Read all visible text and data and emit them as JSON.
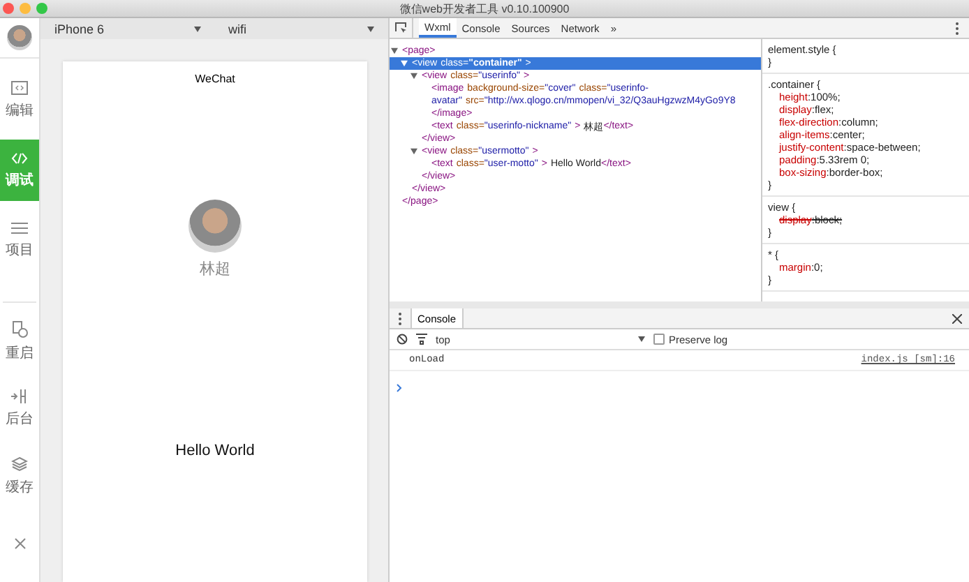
{
  "window": {
    "title": "微信web开发者工具 v0.10.100900"
  },
  "sidebar": {
    "items": [
      {
        "label": "编辑",
        "selected": false
      },
      {
        "label": "调试",
        "selected": true
      },
      {
        "label": "项目",
        "selected": false
      }
    ],
    "bottom_items": [
      {
        "label": "重启",
        "selected": false
      },
      {
        "label": "后台",
        "selected": false
      },
      {
        "label": "缓存",
        "selected": false
      },
      {
        "selected": false
      }
    ]
  },
  "simulator": {
    "device": "iPhone 6",
    "network": "wifi",
    "nav_title": "WeChat",
    "nickname": "林超",
    "motto": "Hello World"
  },
  "devtools": {
    "tabs": [
      {
        "label": "Wxml",
        "selected": true
      },
      {
        "label": "Console",
        "selected": false
      },
      {
        "label": "Sources",
        "selected": false
      },
      {
        "label": "Network",
        "selected": false
      }
    ],
    "more": "»",
    "tree": [
      {
        "kind": "element",
        "expanded": true,
        "selected": false,
        "open": [
          [
            {
              "kind": "tag",
              "s": "<page>"
            }
          ]
        ],
        "close": [
          {
            "kind": "tag",
            "s": "</page>"
          }
        ],
        "children": [
          {
            "kind": "element",
            "expanded": true,
            "selected": true,
            "open": [
              [
                {
                  "kind": "tag",
                  "s": "<view"
                },
                {
                  "kind": "attr",
                  "s": "class="
                },
                {
                  "kind": "value",
                  "s": "\"container\""
                },
                {
                  "kind": "tag",
                  "s": ">"
                }
              ]
            ],
            "close": [
              {
                "kind": "tag",
                "s": "</view>"
              }
            ],
            "children": [
              {
                "kind": "element",
                "expanded": true,
                "selected": false,
                "open": [
                  [
                    {
                      "kind": "tag",
                      "s": "<view"
                    },
                    {
                      "kind": "attr",
                      "s": "class="
                    },
                    {
                      "kind": "value",
                      "s": "\"userinfo\""
                    },
                    {
                      "kind": "tag",
                      "s": ">"
                    }
                  ]
                ],
                "close": [
                  {
                    "kind": "tag",
                    "s": "</view>"
                  }
                ],
                "children": [
                  {
                    "kind": "leaf",
                    "selected": false,
                    "open": [
                      [
                        {
                          "kind": "tag",
                          "s": "<image"
                        },
                        {
                          "kind": "attr",
                          "s": "background-size="
                        },
                        {
                          "kind": "value",
                          "s": "\"cover\""
                        },
                        {
                          "kind": "attr",
                          "s": "class="
                        },
                        {
                          "kind": "value",
                          "s": "\"userinfo-"
                        }
                      ],
                      [
                        {
                          "kind": "value",
                          "s": "avatar\""
                        },
                        {
                          "kind": "attr",
                          "s": "src="
                        },
                        {
                          "kind": "value",
                          "s": "\"http://wx.qlogo.cn/mmopen/vi_32/Q3auHgzwzM4yGo9Y8"
                        }
                      ]
                    ],
                    "close": [
                      {
                        "kind": "tag",
                        "s": "</image>"
                      }
                    ]
                  },
                  {
                    "kind": "leaf",
                    "selected": false,
                    "open": [
                      [
                        {
                          "kind": "tag",
                          "s": "<text"
                        },
                        {
                          "kind": "attr",
                          "s": "class="
                        },
                        {
                          "kind": "value",
                          "s": "\"userinfo-nickname\""
                        },
                        {
                          "kind": "tag",
                          "s": ">"
                        },
                        {
                          "kind": "text",
                          "s": "林超"
                        },
                        {
                          "kind": "tag",
                          "s": "</text>"
                        }
                      ]
                    ]
                  }
                ]
              },
              {
                "kind": "element",
                "expanded": true,
                "selected": false,
                "open": [
                  [
                    {
                      "kind": "tag",
                      "s": "<view"
                    },
                    {
                      "kind": "attr",
                      "s": "class="
                    },
                    {
                      "kind": "value",
                      "s": "\"usermotto\""
                    },
                    {
                      "kind": "tag",
                      "s": ">"
                    }
                  ]
                ],
                "close": [
                  {
                    "kind": "tag",
                    "s": "</view>"
                  }
                ],
                "children": [
                  {
                    "kind": "leaf",
                    "selected": false,
                    "open": [
                      [
                        {
                          "kind": "tag",
                          "s": "<text"
                        },
                        {
                          "kind": "attr",
                          "s": "class="
                        },
                        {
                          "kind": "value",
                          "s": "\"user-motto\""
                        },
                        {
                          "kind": "tag",
                          "s": ">"
                        },
                        {
                          "kind": "text",
                          "s": "Hello World"
                        },
                        {
                          "kind": "tag",
                          "s": "</text>"
                        }
                      ]
                    ]
                  }
                ]
              }
            ]
          }
        ]
      }
    ],
    "styles": [
      {
        "selector": "element.style {",
        "close": "}"
      },
      {
        "selector": ".container {",
        "close": "}",
        "declarations": [
          {
            "prop": "height",
            "value": ":100%;",
            "struck": false
          },
          {
            "prop": "display",
            "value": ":flex;",
            "struck": false
          },
          {
            "prop": "flex-direction",
            "value": ":column;",
            "struck": false
          },
          {
            "prop": "align-items",
            "value": ":center;",
            "struck": false
          },
          {
            "prop": "justify-content",
            "value": ":space-between;",
            "struck": false
          },
          {
            "prop": "padding",
            "value": ":5.33rem 0;",
            "struck": false
          },
          {
            "prop": "box-sizing",
            "value": ":border-box;",
            "struck": false
          }
        ]
      },
      {
        "selector": "view {",
        "close": "}",
        "declarations": [
          {
            "prop": "display",
            "value": ":block;",
            "struck": true
          }
        ]
      },
      {
        "selector": "* {",
        "close": "}",
        "declarations": [
          {
            "prop": "margin",
            "value": ":0;",
            "struck": false
          }
        ]
      }
    ],
    "console": {
      "tab": "Console",
      "context": "top",
      "preserve_log": {
        "label": "Preserve log",
        "checked": false
      },
      "entries": [
        {
          "message": "onLoad",
          "source": "index.js [sm]:16"
        }
      ]
    }
  }
}
